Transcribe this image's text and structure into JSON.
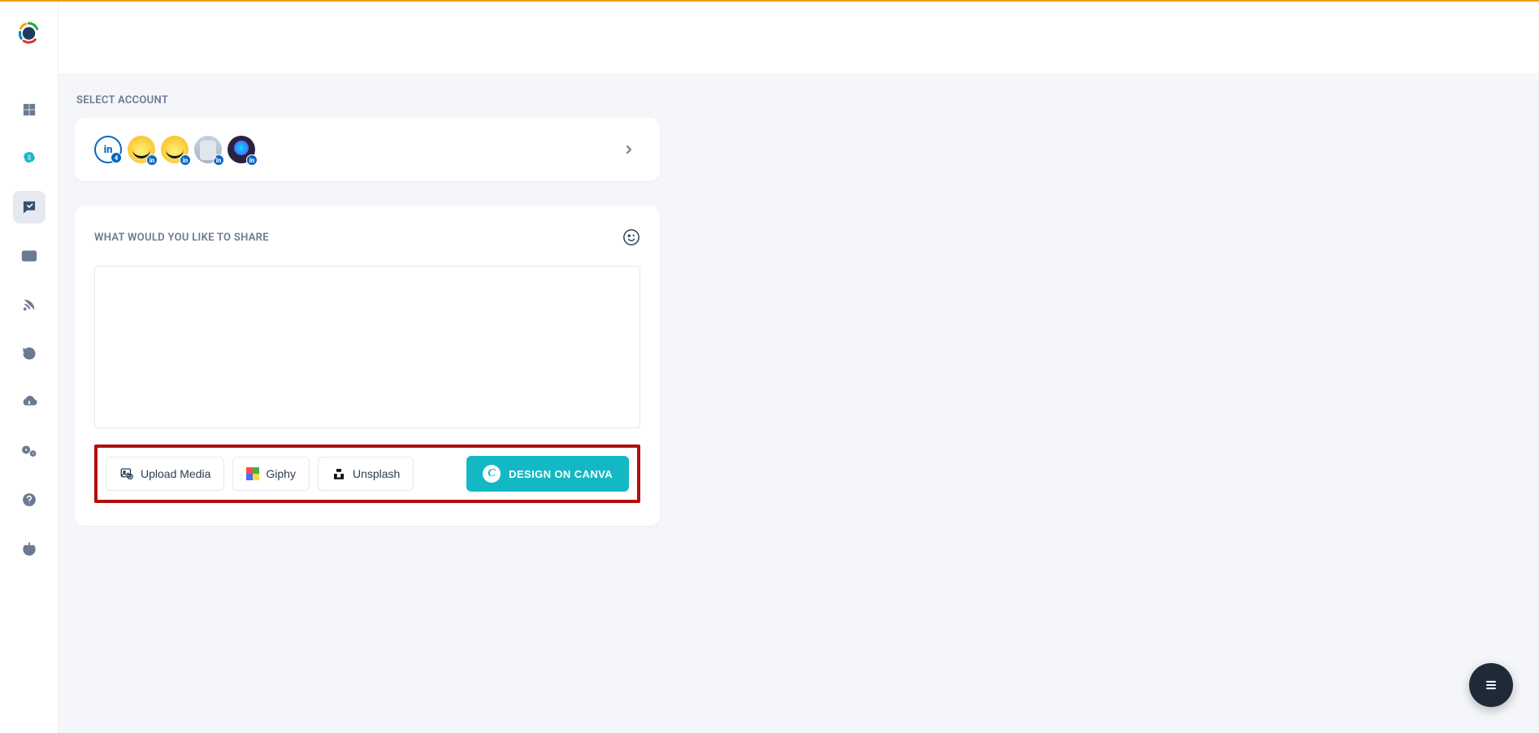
{
  "accountSection": {
    "title": "SELECT ACCOUNT"
  },
  "accounts": {
    "linkedinBadgeCount": "4"
  },
  "compose": {
    "title": "WHAT WOULD YOU LIKE TO SHARE",
    "placeholder": ""
  },
  "toolbar": {
    "upload_label": "Upload Media",
    "giphy_label": "Giphy",
    "unsplash_label": "Unsplash",
    "canva_label": "DESIGN ON CANVA"
  }
}
